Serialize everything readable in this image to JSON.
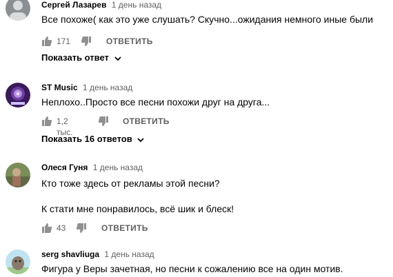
{
  "comments": [
    {
      "author": "Сергей Лазарев",
      "time": "1 день назад",
      "lines": [
        "Все похоже( как это уже слушать? Скучно...ожидания немного иные были"
      ],
      "likes": "171",
      "reply_label": "ОТВЕТИТЬ",
      "show_replies": "Показать ответ"
    },
    {
      "author": "ST Music",
      "time": "1 день назад",
      "lines": [
        "Неплохо..Просто все песни похожи друг на друга..."
      ],
      "likes": "1,2 тыс.",
      "reply_label": "ОТВЕТИТЬ",
      "show_replies": "Показать 16 ответов"
    },
    {
      "author": "Олеся Гуня",
      "time": "1 день назад",
      "lines": [
        "Кто тоже здесь от рекламы этой песни?",
        "К стати мне понравилось, всё шик и блеск!"
      ],
      "likes": "43",
      "reply_label": "ОТВЕТИТЬ"
    },
    {
      "author": "serg shavliuga",
      "time": "1 день назад",
      "lines": [
        "Фигура у Веры зачетная, но песни к сожалению все на один мотив."
      ]
    }
  ],
  "colors": {
    "avatar_gray": "#8a8f94",
    "avatar_purple": "#3a1a5a",
    "avatar_green": "#7b8d5a",
    "avatar_sky": "#bfe3f0",
    "icon_gray": "#909090"
  }
}
